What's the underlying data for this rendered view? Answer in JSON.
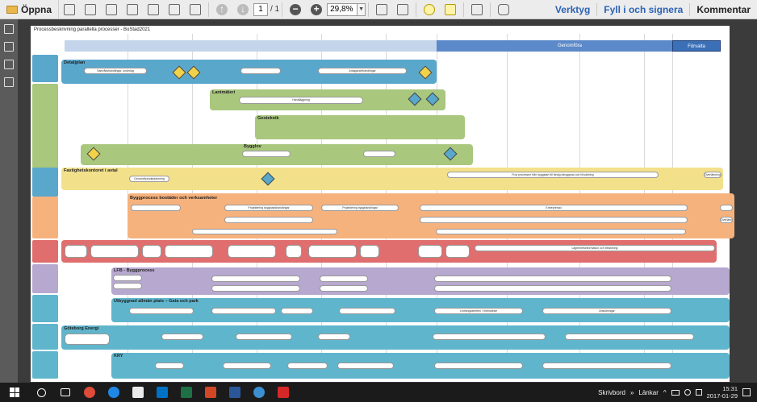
{
  "toolbar": {
    "open_label": "Öppna",
    "page_current": "1",
    "page_total": "/ 1",
    "zoom_value": "29,8%",
    "tools_label": "Verktyg",
    "fill_sign_label": "Fyll i och signera",
    "comment_label": "Kommentar"
  },
  "document": {
    "title": "Processbeskrivning parallella processer - BoStad2021",
    "timeline_mid": "Genomföra",
    "timeline_end": "Förvalta",
    "bands": {
      "detaljplan": "Detaljplan",
      "lantmateri": "Lantmäteri",
      "geoteknik": "Geoteknik",
      "bygglov": "Bygglov",
      "fastighetskontor": "Fastighetskontoret i avtal",
      "byggprocess": "Byggprocess bostäder och verksamheter",
      "lfb": "LFB - Byggprocess",
      "gata": "Utbyggnad allmän plats – Gata och park",
      "energi": "Göteborg Energi",
      "kry": "KRY"
    },
    "pills": {
      "antagande": "Antagandehandlingar",
      "samrad": "Samrådshandlingar, underlag",
      "handlaggning": "Handläggning",
      "genomforande": "Genomförandeplanering",
      "projektering": "Projektering byggnadshandlingar",
      "entreprenad": "Entreprenad",
      "overlamning": "Överlämning",
      "utlysning": "Projektering bygghandlingar",
      "ledning": "Ledningsarbeten / förbindelse",
      "anslutningar": "Anslutningar",
      "slutbesked": "Slutbesked",
      "lagenhet": "Lägenhetsinformation och besiktning",
      "fixa": "Fixa processen från byggstart till färdig utbyggnad och förvaltning"
    }
  },
  "taskbar": {
    "desktop_label": "Skrivbord",
    "links_label": "Länkar",
    "time": "15:31",
    "date": "2017-01-29"
  },
  "colors": {
    "blue_lane": "#5aa7cc",
    "green_lane": "#a9c77d",
    "yellow_lane": "#f3e08a",
    "orange_lane": "#f6b27d",
    "red_lane": "#e06e6e",
    "purple_lane": "#b7a8d0",
    "teal_lane": "#5fb5cc"
  }
}
